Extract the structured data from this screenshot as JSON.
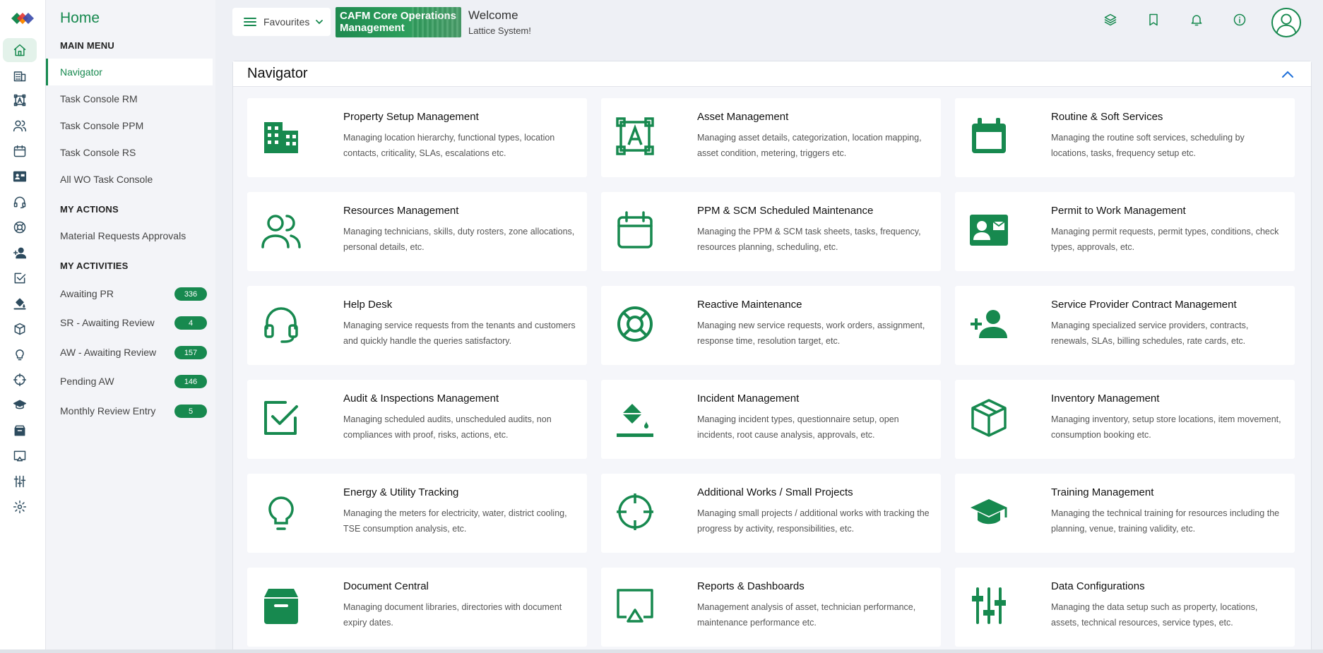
{
  "menu": {
    "title": "Home",
    "main_menu_label": "MAIN MENU",
    "main_items": [
      "Navigator",
      "Task Console RM",
      "Task Console PPM",
      "Task Console RS",
      "All WO Task Console"
    ],
    "my_actions_label": "MY ACTIONS",
    "actions_items": [
      "Material Requests Approvals"
    ],
    "my_activities_label": "MY ACTIVITIES",
    "activities": [
      {
        "label": "Awaiting PR",
        "count": "336"
      },
      {
        "label": "SR - Awaiting Review",
        "count": "4"
      },
      {
        "label": "AW - Awaiting Review",
        "count": "157"
      },
      {
        "label": "Pending AW",
        "count": "146"
      },
      {
        "label": "Monthly Review Entry",
        "count": "5"
      }
    ]
  },
  "topbar": {
    "favourites_label": "Favourites",
    "banner_text": "CAFM Core Operations Management",
    "welcome": "Welcome",
    "user": "Lattice System!"
  },
  "navigator": {
    "title": "Navigator",
    "cards": [
      {
        "title": "Property Setup Management",
        "desc": "Managing location hierarchy, functional types, location contacts, criticality, SLAs, escalations etc.",
        "icon": "building-icon"
      },
      {
        "title": "Asset Management",
        "desc": "Managing asset details, categorization, location mapping, asset condition, metering, triggers etc.",
        "icon": "asset-icon"
      },
      {
        "title": "Routine & Soft Services",
        "desc": "Managing the routine soft services, scheduling by locations, tasks, frequency setup etc.",
        "icon": "calendar-filled-icon"
      },
      {
        "title": "Resources Management",
        "desc": "Managing technicians, skills, duty rosters, zone allocations, personal details, etc.",
        "icon": "users-icon"
      },
      {
        "title": "PPM & SCM Scheduled Maintenance",
        "desc": "Managing the PPM & SCM task sheets, tasks, frequency, resources planning, scheduling, etc.",
        "icon": "calendar-icon"
      },
      {
        "title": "Permit to Work Management",
        "desc": "Managing permit requests, permit types, conditions, check types, approvals, etc.",
        "icon": "id-card-icon"
      },
      {
        "title": "Help Desk",
        "desc": "Managing service requests from the tenants and customers and quickly handle the queries satisfactory.",
        "icon": "headset-icon"
      },
      {
        "title": "Reactive Maintenance",
        "desc": "Managing new service requests, work orders, assignment, response time, resolution target, etc.",
        "icon": "lifebuoy-icon"
      },
      {
        "title": "Service Provider Contract Management",
        "desc": "Managing specialized service providers, contracts, renewals, SLAs, billing schedules, rate cards, etc.",
        "icon": "user-plus-icon"
      },
      {
        "title": "Audit & Inspections Management",
        "desc": "Managing scheduled audits, unscheduled audits, non compliances with proof, risks, actions, etc.",
        "icon": "check-square-icon"
      },
      {
        "title": "Incident Management",
        "desc": "Managing incident types, questionnaire setup, open incidents, root cause analysis, approvals, etc.",
        "icon": "paint-bucket-icon"
      },
      {
        "title": "Inventory Management",
        "desc": "Managing inventory, setup store locations, item movement, consumption booking etc.",
        "icon": "box-icon"
      },
      {
        "title": "Energy & Utility Tracking",
        "desc": "Managing the meters for electricity, water, district cooling, TSE consumption analysis, etc.",
        "icon": "lightbulb-icon"
      },
      {
        "title": "Additional Works / Small Projects",
        "desc": "Managing small projects / additional works with tracking the progress by activity, responsibilities, etc.",
        "icon": "crosshair-icon"
      },
      {
        "title": "Training Management",
        "desc": "Managing the technical training for resources including the planning, venue, training validity, etc.",
        "icon": "graduation-cap-icon"
      },
      {
        "title": "Document Central",
        "desc": "Managing document libraries, directories with document expiry dates.",
        "icon": "archive-icon"
      },
      {
        "title": "Reports & Dashboards",
        "desc": "Management analysis of asset, technician performance, maintenance performance etc.",
        "icon": "monitor-icon"
      },
      {
        "title": "Data Configurations",
        "desc": "Managing the data setup such as property, locations, assets, technical resources, service types, etc.",
        "icon": "sliders-icon"
      }
    ]
  },
  "colors": {
    "accent": "#17894f",
    "rail_icon": "#2d4b5e"
  }
}
